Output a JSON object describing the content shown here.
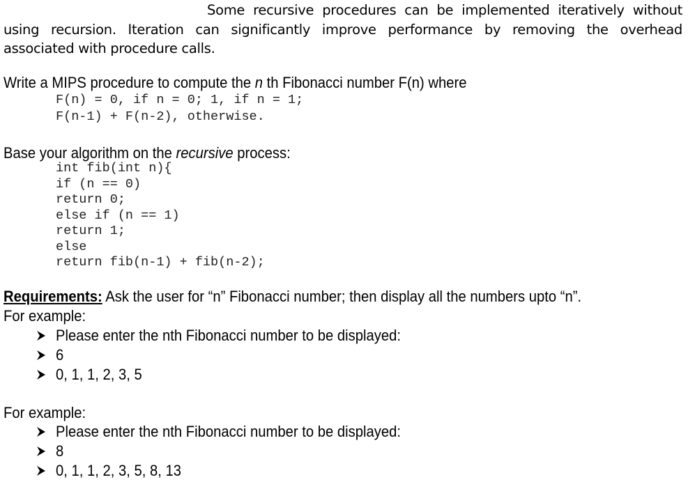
{
  "intro": {
    "line1": "Some recursive procedures can be implemented iteratively without",
    "line2": "using recursion. Iteration can significantly improve performance by removing the overhead",
    "line3": "associated with procedure calls."
  },
  "task": {
    "prefix": "Write a MIPS procedure to compute the ",
    "italic": "n",
    "suffix": " th Fibonacci number F(n) where",
    "formula_line1": "F(n) = 0, if n = 0; 1, if n = 1;",
    "formula_line2": "F(n-1) + F(n-2), otherwise."
  },
  "base": {
    "prefix": "Base your algorithm on the ",
    "italic": "recursive",
    "suffix": " process:",
    "code": [
      "int fib(int n){",
      "if (n == 0)",
      "      return 0;",
      "else if (n == 1)",
      "      return 1;",
      "else",
      "      return fib(n-1) + fib(n-2);"
    ]
  },
  "requirements": {
    "label": "Requirements:",
    "text": " Ask the user for “n” Fibonacci number; then display all the numbers upto “n”.",
    "examples": [
      {
        "heading": "For example:",
        "items": [
          "Please enter the nth Fibonacci number to be displayed:",
          "6",
          "0, 1, 1, 2, 3, 5"
        ]
      },
      {
        "heading": "For example:",
        "items": [
          "Please enter the nth Fibonacci number to be displayed:",
          "8",
          "0, 1, 1, 2, 3, 5, 8, 13"
        ]
      }
    ]
  }
}
